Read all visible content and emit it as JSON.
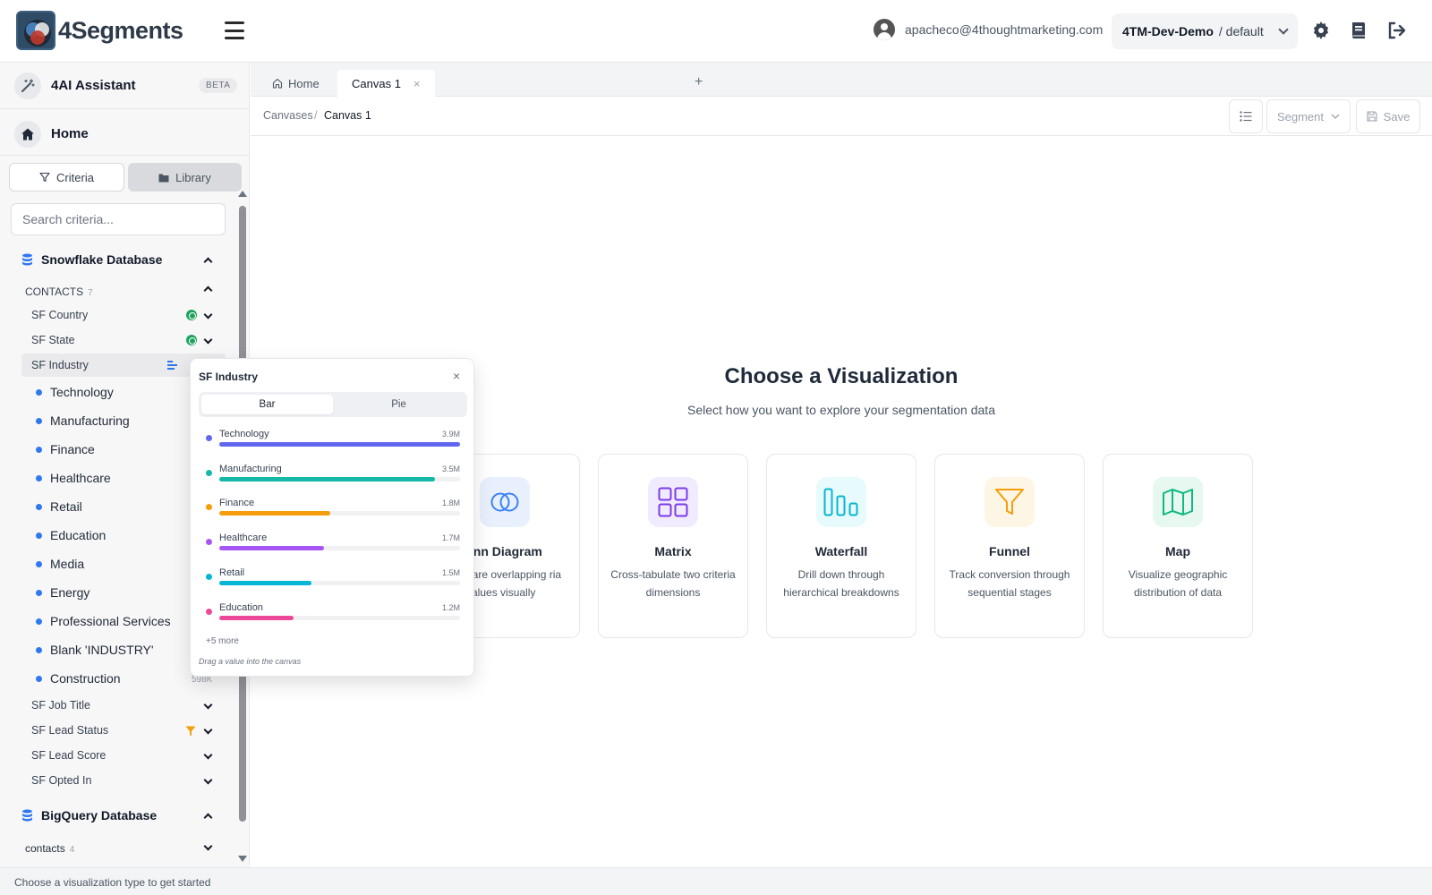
{
  "header": {
    "logo_text": "4Segments",
    "user_email": "apacheco@4thoughtmarketing.com",
    "tenant": "4TM-Dev-Demo",
    "environment": "/ default"
  },
  "sidebar": {
    "assistant_label": "4AI Assistant",
    "beta_label": "BETA",
    "home_label": "Home",
    "tabs": [
      {
        "label": "Criteria",
        "icon": "filter-icon",
        "active": true
      },
      {
        "label": "Library",
        "icon": "folder-icon",
        "active": false
      }
    ],
    "search_placeholder": "Search criteria...",
    "databases": [
      {
        "name": "Snowflake Database",
        "groups": [
          {
            "name": "CONTACTS",
            "count": "7",
            "criteria": [
              {
                "label": "SF Country",
                "icon": "globe-icon"
              },
              {
                "label": "SF State",
                "icon": "globe-icon"
              },
              {
                "label": "SF Industry",
                "icon": "bar-chart-icon",
                "expanded": true,
                "values": [
                  "Technology",
                  "Manufacturing",
                  "Finance",
                  "Healthcare",
                  "Retail",
                  "Education",
                  "Media",
                  "Energy",
                  "Professional Services",
                  "Blank 'INDUSTRY'",
                  "Construction"
                ],
                "last_count": "598K"
              },
              {
                "label": "SF Job Title"
              },
              {
                "label": "SF Lead Status",
                "icon": "filter-icon"
              },
              {
                "label": "SF Lead Score"
              },
              {
                "label": "SF Opted In"
              }
            ]
          }
        ]
      },
      {
        "name": "BigQuery Database",
        "groups": [
          {
            "name": "contacts",
            "count": "4"
          }
        ]
      }
    ]
  },
  "tabs": {
    "home_label": "Home",
    "canvas_label": "Canvas 1",
    "close_glyph": "×",
    "add_glyph": "+"
  },
  "breadcrumb": {
    "parent": "Canvases",
    "separator": "/",
    "current": "Canvas 1"
  },
  "toolbar": {
    "segment_label": "Segment",
    "save_label": "Save"
  },
  "main": {
    "title": "Choose a Visualization",
    "subtitle": "Select how you want to explore your segmentation data",
    "cards": [
      {
        "title": "enn Diagram",
        "desc": "pare overlapping ria values visually",
        "icon": "venn-icon",
        "color": "#3b82f6"
      },
      {
        "title": "Matrix",
        "desc": "Cross-tabulate two criteria dimensions",
        "icon": "grid-icon",
        "color": "#7c3aed"
      },
      {
        "title": "Waterfall",
        "desc": "Drill down through hierarchical breakdowns",
        "icon": "waterfall-icon",
        "color": "#06b6d4"
      },
      {
        "title": "Funnel",
        "desc": "Track conversion through sequential stages",
        "icon": "funnel-icon",
        "color": "#f59e0b"
      },
      {
        "title": "Map",
        "desc": "Visualize geographic distribution of data",
        "icon": "map-icon",
        "color": "#10b981"
      }
    ]
  },
  "popover": {
    "title": "SF Industry",
    "close_glyph": "×",
    "toggle": [
      "Bar",
      "Pie"
    ],
    "more": "+5 more",
    "hint": "Drag a value into the canvas",
    "items": [
      {
        "label": "Technology",
        "value": "3.9M",
        "num": 3.9,
        "color": "#6366f1"
      },
      {
        "label": "Manufacturing",
        "value": "3.5M",
        "num": 3.5,
        "color": "#14b8a6"
      },
      {
        "label": "Finance",
        "value": "1.8M",
        "num": 1.8,
        "color": "#f59e0b"
      },
      {
        "label": "Healthcare",
        "value": "1.7M",
        "num": 1.7,
        "color": "#a855f7"
      },
      {
        "label": "Retail",
        "value": "1.5M",
        "num": 1.5,
        "color": "#06b6d4"
      },
      {
        "label": "Education",
        "value": "1.2M",
        "num": 1.2,
        "color": "#ec4899"
      }
    ]
  },
  "status_bar": "Choose a visualization type to get started"
}
